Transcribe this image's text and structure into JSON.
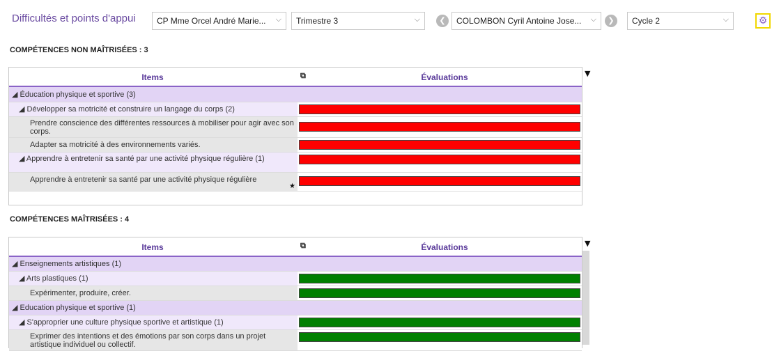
{
  "header": {
    "title": "Difficultés et points d'appui",
    "class_select": "CP Mme Orcel André Marie...",
    "period_select": "Trimestre 3",
    "student_select": "COLOMBON Cyril Antoine Jose...",
    "cycle_select": "Cycle 2",
    "chevron": "⌵",
    "prev_icon": "❮",
    "next_icon": "❯",
    "settings_icon": "⚙"
  },
  "sections": {
    "not_mastered": {
      "title": "COMPÉTENCES NON MAÎTRISÉES : 3",
      "col_items": "Items",
      "col_evaluations": "Évaluations",
      "rows": [
        {
          "label": "◢ Éducation physique et sportive (3)"
        },
        {
          "label": "◢ Développer sa motricité et construire un langage du corps (2)"
        },
        {
          "label": "Prendre conscience des différentes ressources à mobiliser pour agir avec son corps."
        },
        {
          "label": "Adapter sa motricité à des environnements variés."
        },
        {
          "label": "◢ Apprendre à entretenir sa santé par une activité physique régulière (1)"
        },
        {
          "label": "Apprendre à entretenir sa santé par une activité physique régulière"
        }
      ],
      "bar_color": "#ff0000"
    },
    "mastered": {
      "title": "COMPÉTENCES MAÎTRISÉES : 4",
      "col_items": "Items",
      "col_evaluations": "Évaluations",
      "rows": [
        {
          "label": "◢ Enseignements artistiques (1)"
        },
        {
          "label": "◢ Arts plastiques (1)"
        },
        {
          "label": "Expérimenter, produire, créer."
        },
        {
          "label": "◢ Education physique et sportive (1)"
        },
        {
          "label": "◢ S'approprier une culture physique sportive et artistique (1)"
        },
        {
          "label": "Exprimer des intentions et des émotions par son corps dans un projet artistique individuel ou collectif."
        }
      ],
      "bar_color": "#008000"
    }
  },
  "icons": {
    "copy": "⧉",
    "column_menu": "▼",
    "star": "★"
  }
}
